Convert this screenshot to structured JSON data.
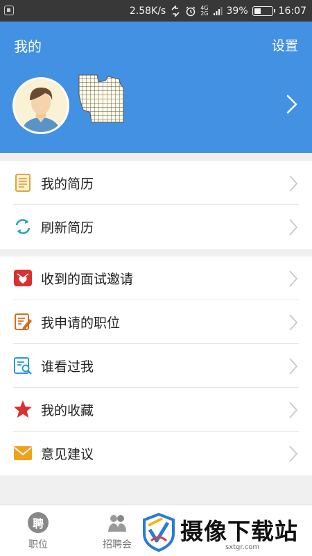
{
  "status_bar": {
    "network_speed": "2.58K/s",
    "net_label_top": "4G",
    "net_label_bottom": "2G",
    "battery_percent": "39%",
    "battery_level": 0.39,
    "time": "16:07"
  },
  "header": {
    "title": "我的",
    "settings_label": "设置",
    "background": "#4391e2"
  },
  "menu_groups": [
    {
      "items": [
        {
          "label": "我的简历",
          "icon": "resume-icon"
        },
        {
          "label": "刷新简历",
          "icon": "refresh-icon"
        }
      ]
    },
    {
      "items": [
        {
          "label": "收到的面试邀请",
          "icon": "interview-invitation-icon"
        },
        {
          "label": "我申请的职位",
          "icon": "applied-jobs-icon"
        },
        {
          "label": "谁看过我",
          "icon": "viewers-icon"
        },
        {
          "label": "我的收藏",
          "icon": "star-icon"
        },
        {
          "label": "意见建议",
          "icon": "mail-icon"
        }
      ]
    }
  ],
  "tab_bar": {
    "tabs": [
      {
        "label": "职位",
        "icon_glyph": "聘"
      },
      {
        "label": "招聘会",
        "icon": "people-icon"
      }
    ]
  },
  "watermark": {
    "text": "摄像下载站",
    "url": "sxtgr.com"
  }
}
